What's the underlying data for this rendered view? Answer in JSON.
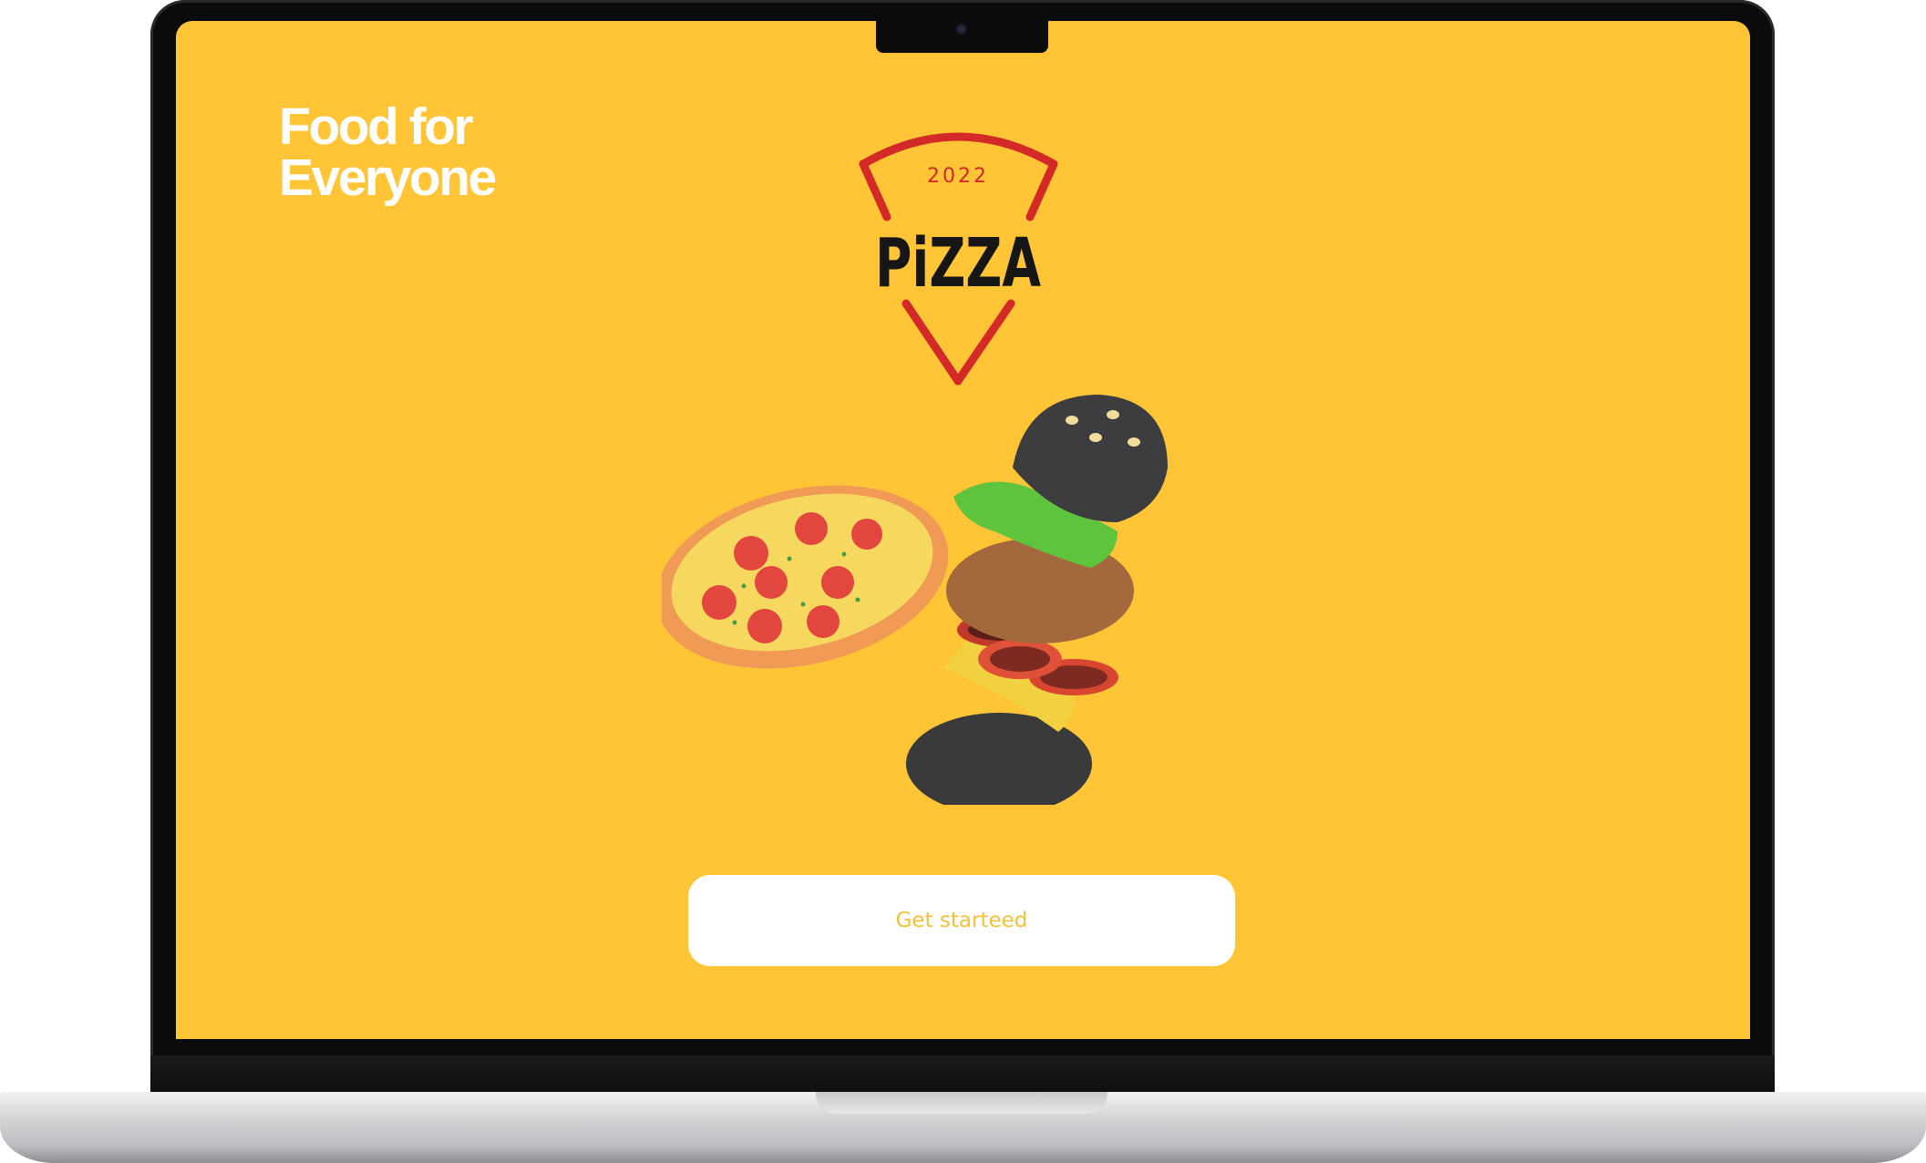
{
  "screen": {
    "background_color": "#ffc537",
    "tagline_line1": "Food for",
    "tagline_line2": "Everyone"
  },
  "logo": {
    "year": "2022",
    "brand": "PiZZA",
    "accent_color": "#d42a27"
  },
  "illustration": {
    "items": [
      "pizza-icon",
      "burger-icon"
    ]
  },
  "cta": {
    "label": "Get starteed",
    "text_color": "#f2c13c"
  }
}
